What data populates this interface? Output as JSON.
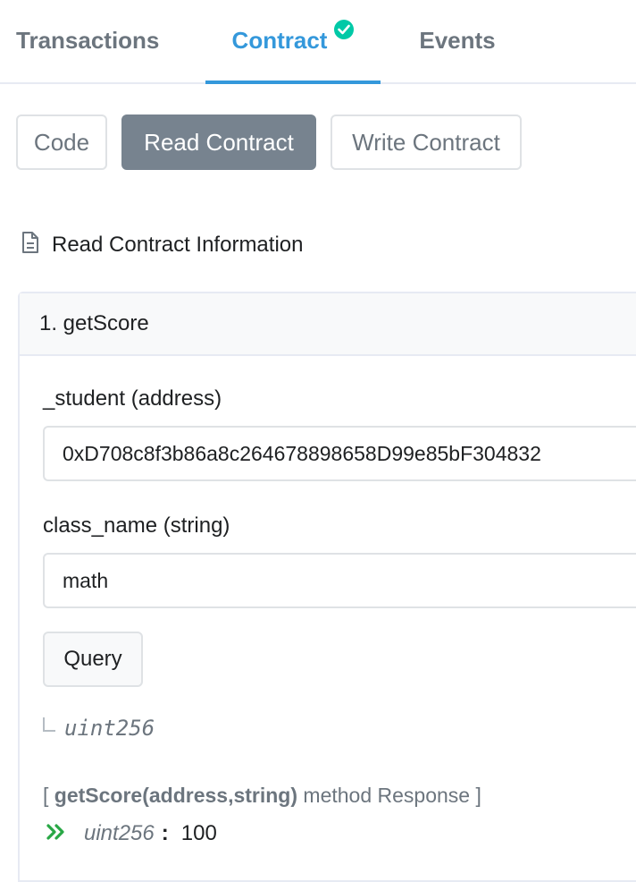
{
  "tabs": {
    "transactions": "Transactions",
    "contract": "Contract",
    "events": "Events"
  },
  "subtabs": {
    "code": "Code",
    "read": "Read Contract",
    "write": "Write Contract"
  },
  "section_title": "Read Contract Information",
  "method": {
    "header": "1. getScore",
    "inputs": [
      {
        "label": "_student (address)",
        "value": "0xD708c8f3b86a8c264678898658D99e85bF304832"
      },
      {
        "label": "class_name (string)",
        "value": "math"
      }
    ],
    "query_label": "Query",
    "return_type": "uint256",
    "response": {
      "open": "[",
      "signature": "getScore(address,string)",
      "suffix": "method Response ]",
      "result_type": "uint256",
      "colon": ":",
      "result_value": "100"
    }
  },
  "colors": {
    "accent": "#3498db",
    "verified": "#00c9a7",
    "active_subtab": "#77838f",
    "result_arrow": "#28a745"
  },
  "icons": {
    "verified": "check-circle-icon",
    "document": "document-icon",
    "return": "corner-down-right-icon",
    "result": "double-chevron-right-icon"
  }
}
